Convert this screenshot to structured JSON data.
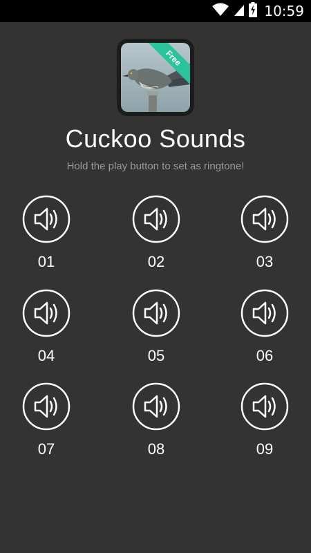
{
  "status_bar": {
    "time": "10:59",
    "icons": [
      "wifi-icon",
      "signal-icon",
      "battery-charging-icon"
    ]
  },
  "app": {
    "title": "Cuckoo Sounds",
    "subtitle": "Hold the play button to set as ringtone!",
    "badge": "Free",
    "accent_color": "#2bc49a",
    "background_color": "#333333"
  },
  "sounds": [
    {
      "label": "01",
      "icon": "speaker-icon"
    },
    {
      "label": "02",
      "icon": "speaker-icon"
    },
    {
      "label": "03",
      "icon": "speaker-icon"
    },
    {
      "label": "04",
      "icon": "speaker-icon"
    },
    {
      "label": "05",
      "icon": "speaker-icon"
    },
    {
      "label": "06",
      "icon": "speaker-icon"
    },
    {
      "label": "07",
      "icon": "speaker-icon"
    },
    {
      "label": "08",
      "icon": "speaker-icon"
    },
    {
      "label": "09",
      "icon": "speaker-icon"
    }
  ]
}
